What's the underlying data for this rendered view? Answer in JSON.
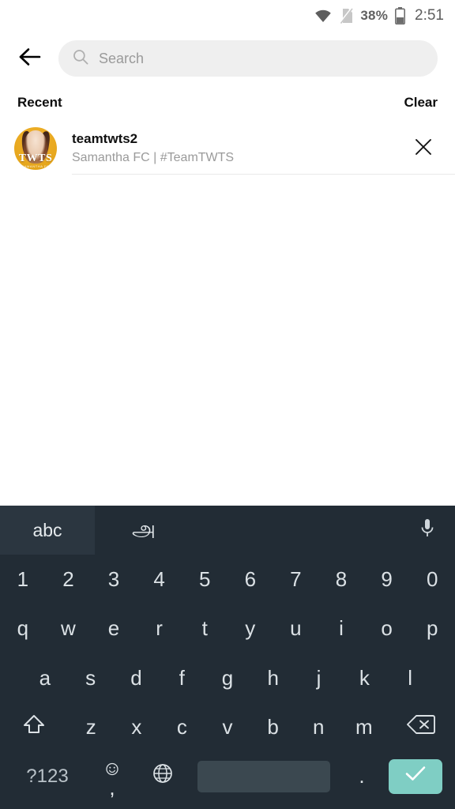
{
  "statusbar": {
    "wifi_icon": "wifi-icon",
    "sim_icon": "no-sim-icon",
    "battery_percent": "38%",
    "battery_icon": "battery-icon",
    "clock": "2:51"
  },
  "appbar": {
    "back_icon": "back-arrow-icon",
    "search": {
      "icon": "search-icon",
      "value": "",
      "placeholder": "Search"
    }
  },
  "recent": {
    "title": "Recent",
    "clear_label": "Clear",
    "items": [
      {
        "avatar_text": "TWTS",
        "avatar_subtag": "SAMANTHA FC",
        "avatar_color": "#e8a81f",
        "username": "teamtwts2",
        "fullname": "Samantha FC | #TeamTWTS",
        "remove_icon": "close-icon"
      }
    ]
  },
  "keyboard": {
    "toolbar": {
      "tab_latin": "abc",
      "tab_tamil": "அ",
      "mic_icon": "microphone-icon"
    },
    "rows": {
      "numbers": [
        "1",
        "2",
        "3",
        "4",
        "5",
        "6",
        "7",
        "8",
        "9",
        "0"
      ],
      "top": [
        "q",
        "w",
        "e",
        "r",
        "t",
        "y",
        "u",
        "i",
        "o",
        "p"
      ],
      "home": [
        "a",
        "s",
        "d",
        "f",
        "g",
        "h",
        "j",
        "k",
        "l"
      ],
      "bottom": [
        "z",
        "x",
        "c",
        "v",
        "b",
        "n",
        "m"
      ]
    },
    "shift_icon": "shift-icon",
    "backspace_icon": "backspace-icon",
    "symbols_label": "?123",
    "emoji_icon": "emoji-icon",
    "comma_label": ",",
    "globe_icon": "globe-icon",
    "space_label": "",
    "period_label": ".",
    "enter_icon": "checkmark-icon",
    "enter_color": "#7fcec4"
  }
}
